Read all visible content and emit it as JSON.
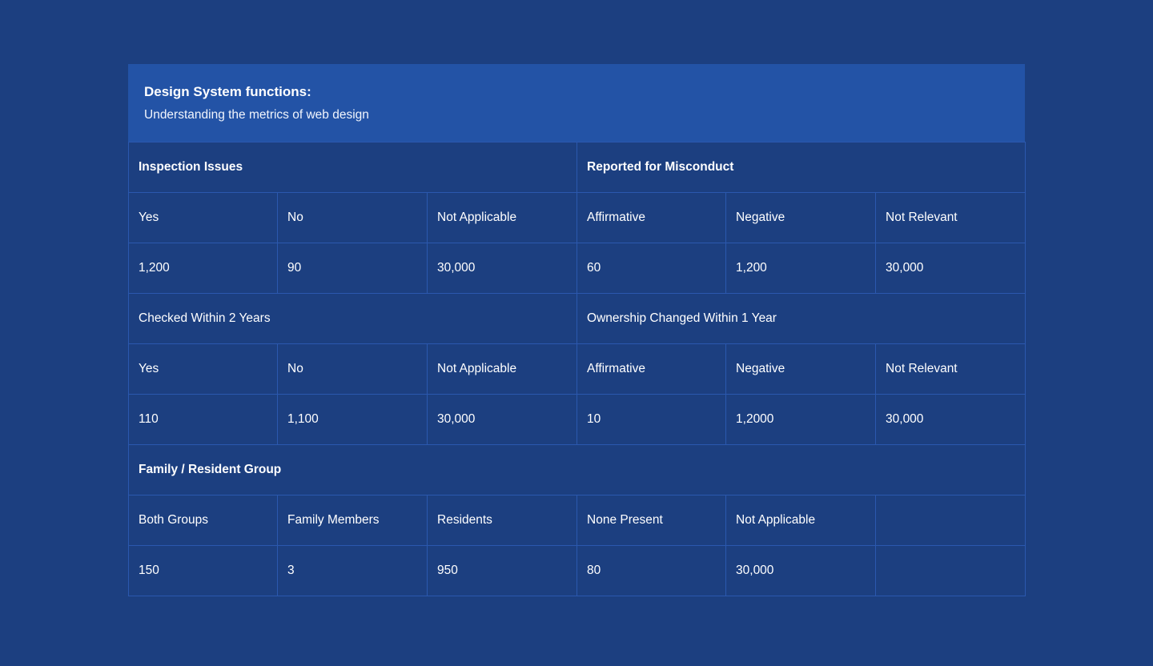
{
  "header": {
    "title": "Design System functions:",
    "subtitle": "Understanding the metrics of web design"
  },
  "sections": [
    {
      "groups": [
        {
          "label": "Inspection Issues",
          "bold": true
        },
        {
          "label": "Reported for Misconduct",
          "bold": true
        }
      ],
      "labels": [
        "Yes",
        "No",
        "Not Applicable",
        "Affirmative",
        "Negative",
        "Not Relevant"
      ],
      "values": [
        "1,200",
        "90",
        "30,000",
        "60",
        "1,200",
        "30,000"
      ]
    },
    {
      "groups": [
        {
          "label": "Checked Within 2 Years",
          "bold": false
        },
        {
          "label": "Ownership Changed Within 1 Year",
          "bold": false
        }
      ],
      "labels": [
        "Yes",
        "No",
        "Not Applicable",
        "Affirmative",
        "Negative",
        "Not Relevant"
      ],
      "values": [
        "110",
        "1,100",
        "30,000",
        "10",
        "1,2000",
        "30,000"
      ]
    },
    {
      "groups": [
        {
          "label": "Family / Resident Group",
          "bold": true
        }
      ],
      "labels": [
        "Both Groups",
        "Family Members",
        "Residents",
        "None Present",
        "Not Applicable",
        ""
      ],
      "values": [
        "150",
        "3",
        "950",
        "80",
        "30,000",
        ""
      ]
    }
  ],
  "colors": {
    "page_background": "#1c3f80",
    "header_background": "#2353a6",
    "grid_line": "#2b58ae",
    "text": "#ffffff"
  }
}
